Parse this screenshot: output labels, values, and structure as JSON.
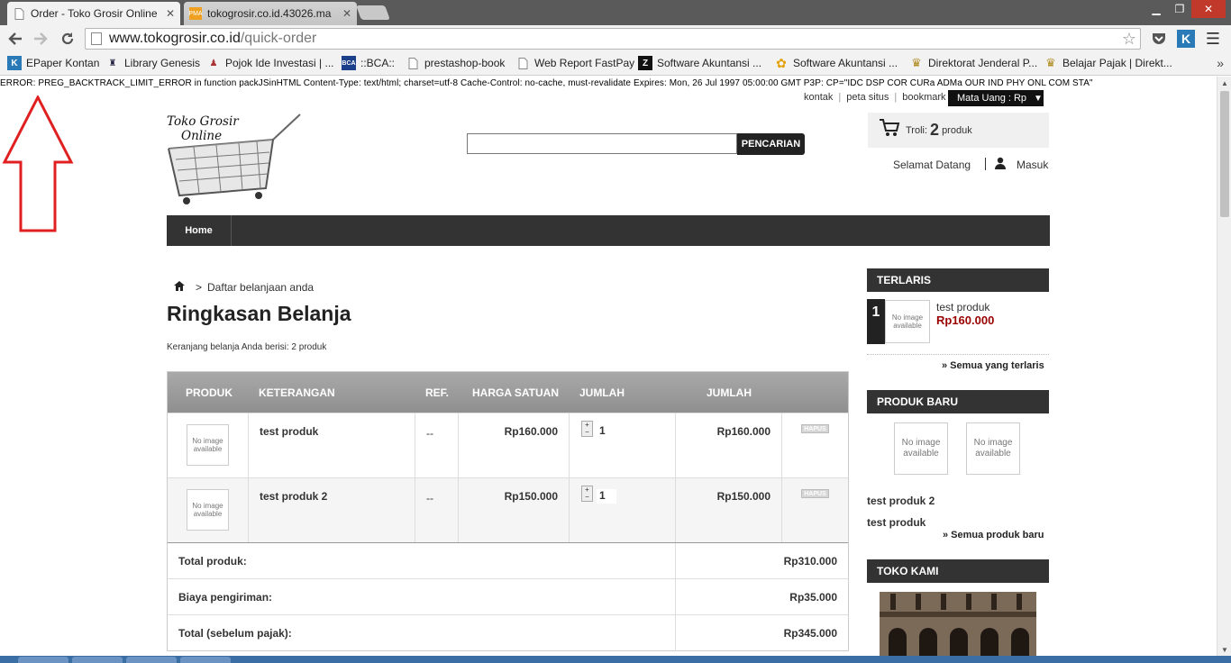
{
  "browser": {
    "tabs": [
      {
        "title": "Order - Toko Grosir Online",
        "active": true
      },
      {
        "title": "tokogrosir.co.id.43026.ma",
        "active": false
      }
    ],
    "url_host": "www.tokogrosir.co.id",
    "url_path": "/quick-order",
    "bookmarks": [
      "EPaper Kontan",
      "Library Genesis",
      "Pojok Ide Investasi | ...",
      "::BCA::",
      "prestashop-book",
      "Web Report FastPay",
      "Software Akuntansi ...",
      "Software Akuntansi ...",
      "Direktorat Jenderal P...",
      "Belajar Pajak | Direkt..."
    ]
  },
  "page": {
    "error_line": "ERROR: PREG_BACKTRACK_LIMIT_ERROR in function packJSinHTML Content-Type: text/html; charset=utf-8 Cache-Control: no-cache, must-revalidate Expires: Mon, 26 Jul 1997 05:00:00 GMT P3P: CP=\"IDC DSP COR CURa ADMa OUR IND PHY ONL COM STA\"",
    "top_links": [
      "kontak",
      "peta situs",
      "bookmark"
    ],
    "currency": "Mata Uang : Rp",
    "logo_line1": "Toko Grosir",
    "logo_line2": "Online",
    "search_button": "PENCARIAN",
    "cart": {
      "label": "Troli:",
      "count": "2",
      "unit": "produk"
    },
    "welcome": "Selamat Datang",
    "login": "Masuk",
    "menu_home": "Home",
    "breadcrumb": "Daftar belanjaan anda",
    "title": "Ringkasan Belanja",
    "cart_summary": "Keranjang belanja Anda berisi: 2 produk",
    "table": {
      "headers": [
        "PRODUK",
        "KETERANGAN",
        "REF.",
        "HARGA SATUAN",
        "JUMLAH",
        "JUMLAH"
      ],
      "rows": [
        {
          "thumb": "No image available",
          "name": "test produk",
          "ref": "--",
          "price": "Rp160.000",
          "qty": "1",
          "total": "Rp160.000",
          "delete": "HAPUS"
        },
        {
          "thumb": "No image available",
          "name": "test produk 2",
          "ref": "--",
          "price": "Rp150.000",
          "qty": "1",
          "total": "Rp150.000",
          "delete": "HAPUS"
        }
      ],
      "summary": [
        {
          "label": "Total produk:",
          "value": "Rp310.000"
        },
        {
          "label": "Biaya pengiriman:",
          "value": "Rp35.000"
        },
        {
          "label": "Total (sebelum pajak):",
          "value": "Rp345.000"
        }
      ]
    },
    "sidebar": {
      "bestsellers_title": "TERLARIS",
      "bestseller": {
        "rank": "1",
        "thumb": "No image available",
        "name": "test produk",
        "price": "Rp160.000"
      },
      "bestsellers_more": "» Semua yang terlaris",
      "new_title": "PRODUK BARU",
      "new_thumbs": [
        "No image available",
        "No image available"
      ],
      "new_products": [
        "test produk 2",
        "test produk"
      ],
      "new_more": "» Semua produk baru",
      "store_title": "TOKO KAMI"
    }
  }
}
